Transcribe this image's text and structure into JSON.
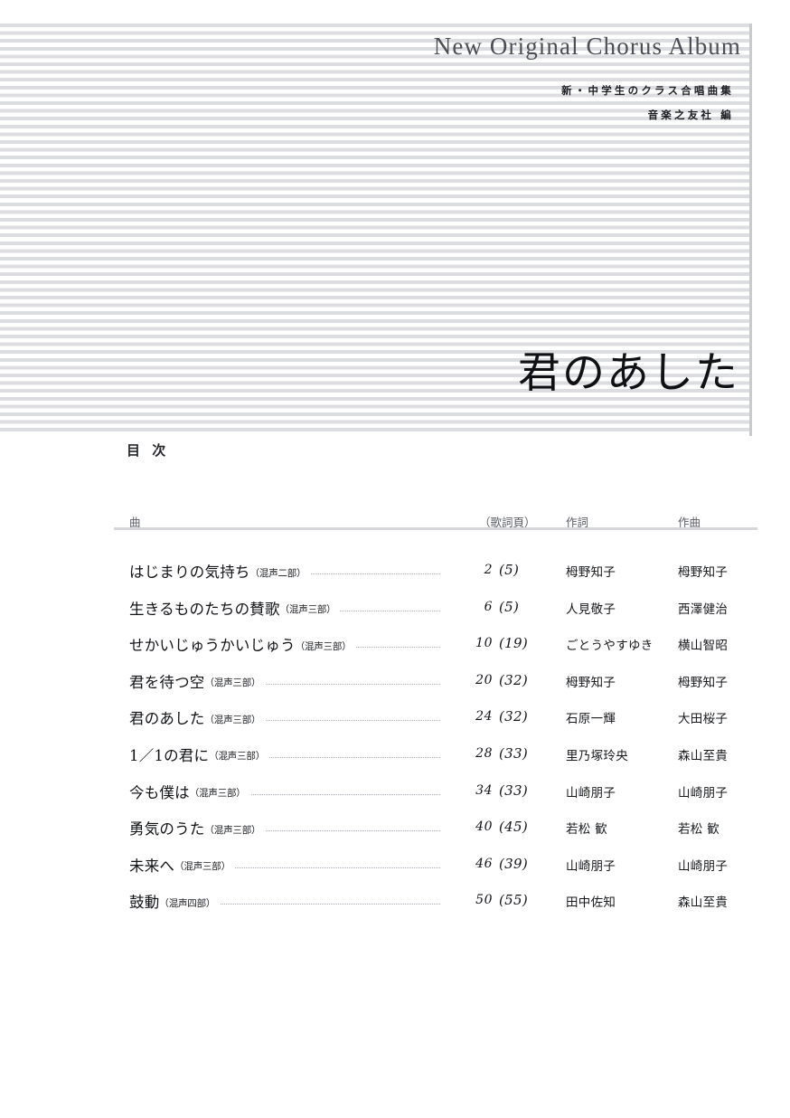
{
  "cover": {
    "album_title_en": "New Original Chorus Album",
    "series_line": "新・中学生のクラス合唱曲集",
    "publisher_line": "音楽之友社 編",
    "main_title_ja": "君のあした",
    "stripe_color": "#dcdde1",
    "stripe_edge_color": "#c9cace",
    "title_en_color": "#4b4e55"
  },
  "toc": {
    "heading": "目 次",
    "rule_color": "#d6d7db",
    "columns": {
      "title": "曲",
      "lyric_page": "（歌詞頁）",
      "lyricist": "作詞",
      "composer": "作曲"
    },
    "entries": [
      {
        "title": "はじまりの気持ち",
        "voicing": "（混声二部）",
        "page": "2",
        "lyric_page": "(5)",
        "lyricist": "栂野知子",
        "composer": "栂野知子"
      },
      {
        "title": "生きるものたちの賛歌",
        "voicing": "（混声三部）",
        "page": "6",
        "lyric_page": "(5)",
        "lyricist": "人見敬子",
        "composer": "西澤健治"
      },
      {
        "title": "せかいじゅうかいじゅう",
        "voicing": "（混声三部）",
        "page": "10",
        "lyric_page": "(19)",
        "lyricist": "ごとうやすゆき",
        "composer": "横山智昭"
      },
      {
        "title": "君を待つ空",
        "voicing": "（混声三部）",
        "page": "20",
        "lyric_page": "(32)",
        "lyricist": "栂野知子",
        "composer": "栂野知子"
      },
      {
        "title": "君のあした",
        "voicing": "（混声三部）",
        "page": "24",
        "lyric_page": "(32)",
        "lyricist": "石原一輝",
        "composer": "大田桜子"
      },
      {
        "title": "1／1の君に",
        "voicing": "（混声三部）",
        "page": "28",
        "lyric_page": "(33)",
        "lyricist": "里乃塚玲央",
        "composer": "森山至貴"
      },
      {
        "title": "今も僕は",
        "voicing": "（混声三部）",
        "page": "34",
        "lyric_page": "(33)",
        "lyricist": "山崎朋子",
        "composer": "山崎朋子"
      },
      {
        "title": "勇気のうた",
        "voicing": "（混声三部）",
        "page": "40",
        "lyric_page": "(45)",
        "lyricist": "若松 歓",
        "composer": "若松 歓"
      },
      {
        "title": "未来へ",
        "voicing": "（混声三部）",
        "page": "46",
        "lyric_page": "(39)",
        "lyricist": "山崎朋子",
        "composer": "山崎朋子"
      },
      {
        "title": "鼓動",
        "voicing": "（混声四部）",
        "page": "50",
        "lyric_page": "(55)",
        "lyricist": "田中佐知",
        "composer": "森山至貴"
      }
    ]
  }
}
